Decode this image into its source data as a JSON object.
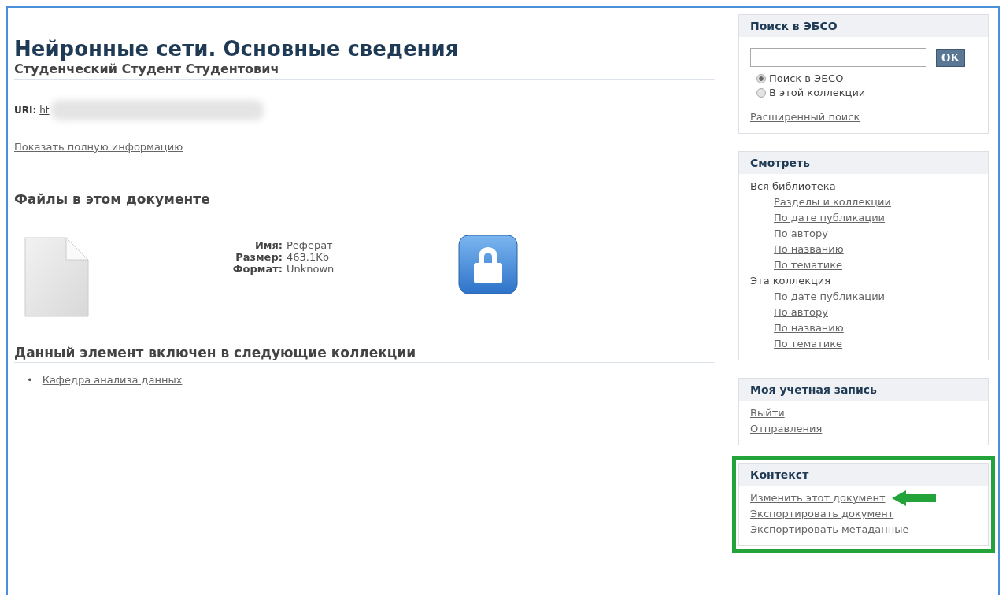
{
  "item": {
    "title": "Нейронные сети. Основные сведения",
    "author": "Студенческий Студент Студентович",
    "uri_label": "URI:",
    "uri_value": "ht",
    "uri_redacted": true,
    "show_full_link": "Показать полную информацию"
  },
  "files": {
    "heading": "Файлы в этом документе",
    "fields": [
      {
        "label": "Имя:",
        "value": "Реферат"
      },
      {
        "label": "Размер:",
        "value": "463.1Kb"
      },
      {
        "label": "Формат:",
        "value": "Unknown"
      }
    ],
    "locked": true
  },
  "collections": {
    "heading": "Данный элемент включен в следующие коллекции",
    "items": [
      {
        "bullet": "•",
        "label": "Кафедра анализа данных"
      }
    ]
  },
  "sidebar": [
    {
      "kind": "search",
      "title": "Поиск в ЭБСО",
      "highlighted": false,
      "button": "OK",
      "options": [
        {
          "label": "Поиск в ЭБСО",
          "selected": true
        },
        {
          "label": "В этой коллекции",
          "selected": false
        }
      ],
      "advanced_link": "Расширенный поиск"
    },
    {
      "kind": "links",
      "title": "Смотреть",
      "highlighted": false,
      "groups": [
        {
          "label": "Вся библиотека",
          "links": [
            {
              "label": "Разделы и коллекции",
              "pointed": false
            },
            {
              "label": "По дате публикации",
              "pointed": false
            },
            {
              "label": "По автору",
              "pointed": false
            },
            {
              "label": "По названию",
              "pointed": false
            },
            {
              "label": "По тематике",
              "pointed": false
            }
          ]
        },
        {
          "label": "Эта коллекция",
          "links": [
            {
              "label": "По дате публикации",
              "pointed": false
            },
            {
              "label": "По автору",
              "pointed": false
            },
            {
              "label": "По названию",
              "pointed": false
            },
            {
              "label": "По тематике",
              "pointed": false
            }
          ]
        }
      ]
    },
    {
      "kind": "links",
      "title": "Моя учетная запись",
      "highlighted": false,
      "groups": [
        {
          "links": [
            {
              "label": "Выйти",
              "pointed": false
            },
            {
              "label": "Отправления",
              "pointed": false
            }
          ]
        }
      ]
    },
    {
      "kind": "links",
      "title": "Контекст",
      "highlighted": true,
      "groups": [
        {
          "links": [
            {
              "label": "Изменить этот документ",
              "pointed": true
            },
            {
              "label": "Экспортировать документ",
              "pointed": false
            },
            {
              "label": "Экспортировать метаданные",
              "pointed": false
            }
          ]
        }
      ]
    }
  ]
}
